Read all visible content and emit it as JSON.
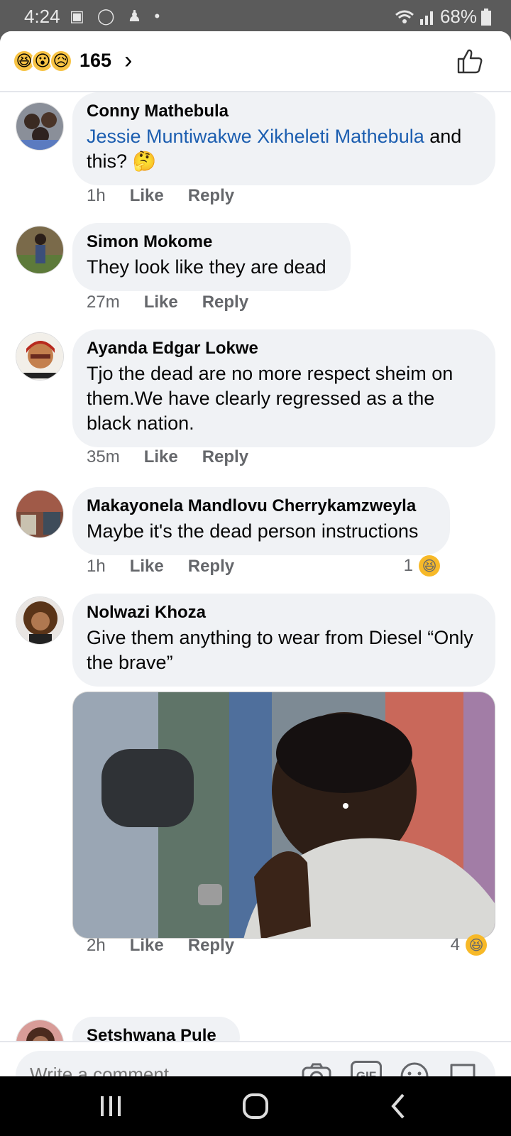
{
  "status": {
    "time": "4:24",
    "battery": "68%",
    "icons": "▣ ◯ ♟ •"
  },
  "header": {
    "reaction_emojis": [
      "😆",
      "😮",
      "😥"
    ],
    "reaction_count": "165"
  },
  "comments": [
    {
      "author": "Conny Mathebula",
      "mention": "Jessie Muntiwakwe Xikheleti Mathebula",
      "text": " and this? 🤔",
      "time": "1h",
      "like": "Like",
      "reply": "Reply"
    },
    {
      "author": "Simon Mokome",
      "text": "They look like they are dead",
      "time": "27m",
      "like": "Like",
      "reply": "Reply"
    },
    {
      "author": "Ayanda Edgar Lokwe",
      "text": "Tjo the dead are no more respect sheim on them.We have clearly regressed as a the black nation.",
      "time": "35m",
      "like": "Like",
      "reply": "Reply"
    },
    {
      "author": "Makayonela Mandlovu Cherrykamzweyla",
      "text": "Maybe it's the dead person instructions",
      "time": "1h",
      "like": "Like",
      "reply": "Reply",
      "reactions": "1"
    },
    {
      "author": "Nolwazi Khoza",
      "text": "Give them anything to wear from Diesel “Only the brave”",
      "time": "2h",
      "like": "Like",
      "reply": "Reply",
      "reactions": "4"
    },
    {
      "author": "Setshwana Pule"
    }
  ],
  "composer": {
    "placeholder": "Write a comment…",
    "gif_label": "GIF"
  },
  "colors": {
    "bubble": "#f0f2f5",
    "mention": "#1c5eb0",
    "meta": "#65676b"
  }
}
